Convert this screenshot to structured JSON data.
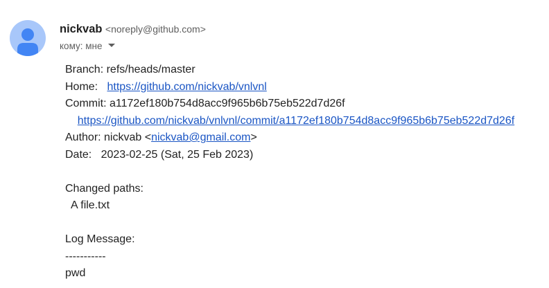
{
  "sender": {
    "name": "nickvab",
    "email": "<noreply@github.com>"
  },
  "recipient": {
    "label": "кому: мне"
  },
  "message": {
    "branch_label": "Branch: ",
    "branch_value": "refs/heads/master",
    "home_label": "Home:   ",
    "home_link": "https://github.com/nickvab/vnlvnl",
    "commit_label": "Commit: ",
    "commit_value": "a1172ef180b754d8acc9f965b6b75eb522d7d26f",
    "commit_indent": "    ",
    "commit_link": "https://github.com/nickvab/vnlvnl/commit/a1172ef180b754d8acc9f965b6b75eb522d7d26f",
    "author_label": "Author: nickvab <",
    "author_email": "nickvab@gmail.com",
    "author_suffix": ">",
    "date_label": "Date:   ",
    "date_value": "2023-02-25 (Sat, 25 Feb 2023)",
    "changed_paths_header": "Changed paths:",
    "changed_path_entry": "  A file.txt",
    "log_header": "Log Message:",
    "log_separator": "-----------",
    "log_text": "pwd"
  }
}
